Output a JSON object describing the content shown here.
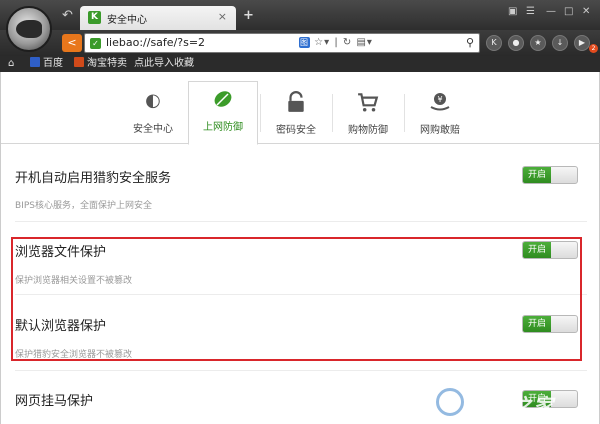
{
  "browser": {
    "tab_title": "安全中心",
    "tab_close": "×",
    "new_tab": "+",
    "address": "liebao://safe/?s=2",
    "addr_tool_label": "图"
  },
  "bookmarks": [
    {
      "label": "百度",
      "color": "#2f5fc8"
    },
    {
      "label": "淘宝特卖",
      "color": "#d04a1a"
    },
    {
      "label": "点此导入收藏",
      "color": ""
    }
  ],
  "nav_tabs": [
    {
      "label": "安全中心",
      "icon": "gauge-icon"
    },
    {
      "label": "上网防御",
      "icon": "leaf-shield-icon",
      "active": true
    },
    {
      "label": "密码安全",
      "icon": "lock-icon"
    },
    {
      "label": "购物防御",
      "icon": "cart-icon"
    },
    {
      "label": "网购敢赔",
      "icon": "money-hand-icon"
    }
  ],
  "settings": [
    {
      "title": "开机自动启用猎豹安全服务",
      "desc": "BIPS核心服务，全面保护上网安全",
      "toggle": "开启"
    },
    {
      "title": "浏览器文件保护",
      "desc": "保护浏览器相关设置不被篡改",
      "toggle": "开启"
    },
    {
      "title": "默认浏览器保护",
      "desc": "保护猎豹安全浏览器不被篡改",
      "toggle": "开启"
    },
    {
      "title": "网页挂马保护",
      "desc": "",
      "toggle": "开启"
    }
  ],
  "colors": {
    "accent_green": "#2e8c1e",
    "highlight_red": "#d9262b",
    "nav_orange": "#e8771c"
  },
  "watermark": "系统之家"
}
